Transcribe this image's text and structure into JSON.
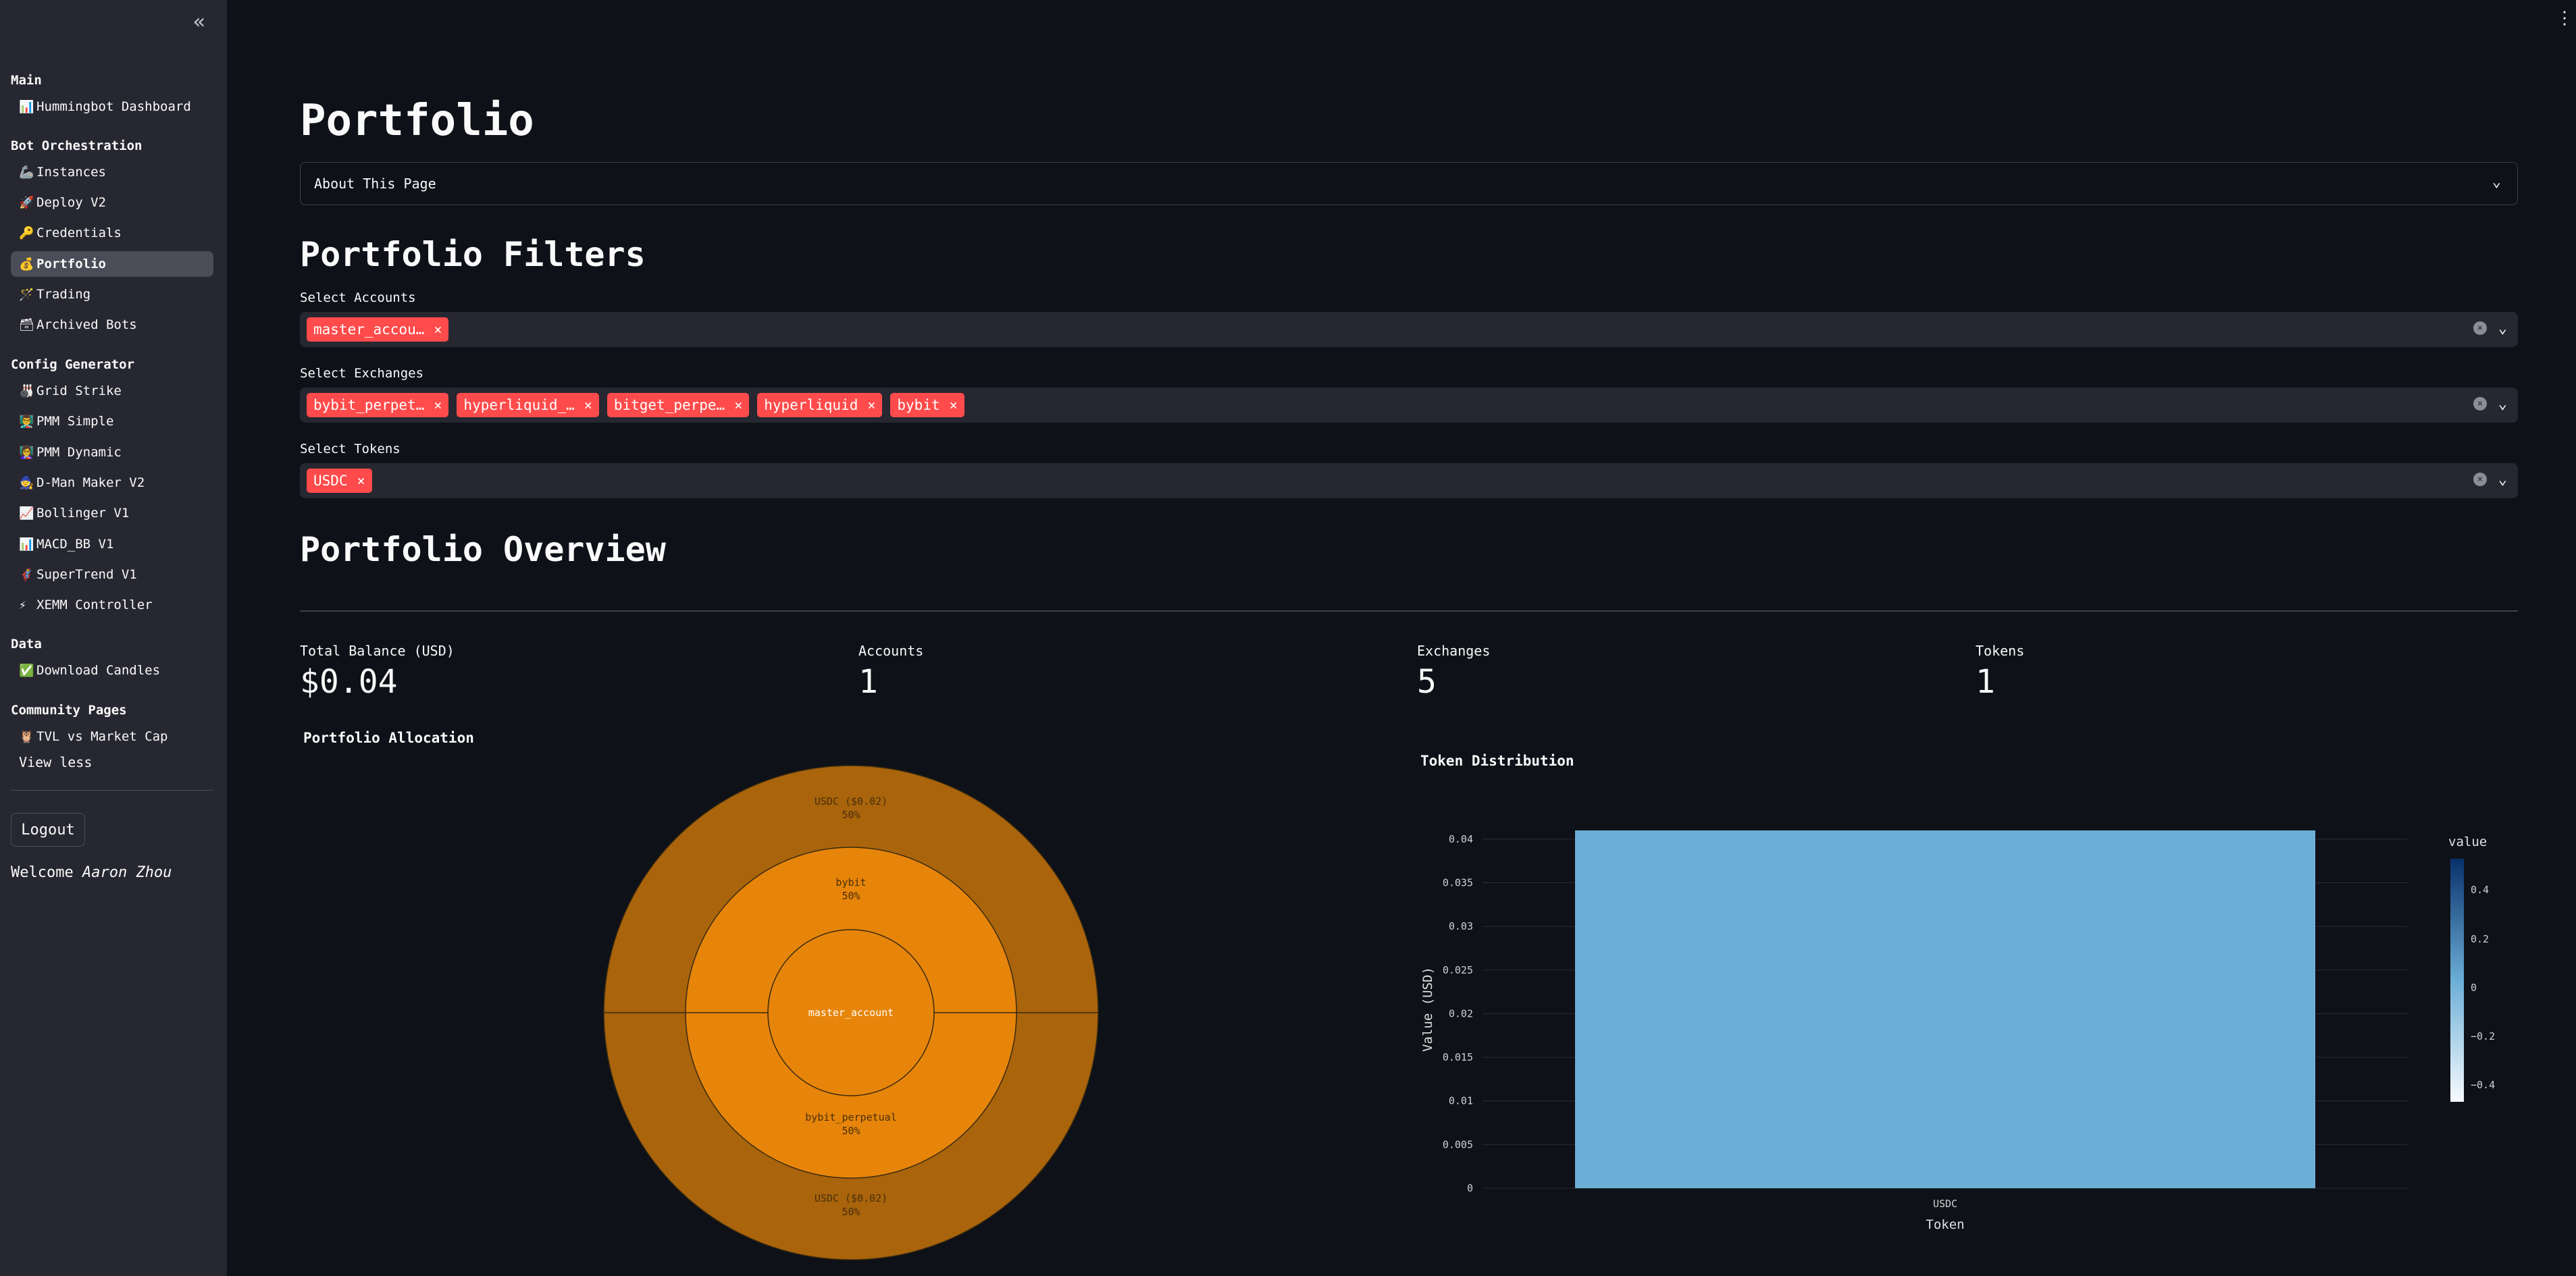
{
  "sidebar": {
    "collapse_icon": "double-chevron-left-icon",
    "groups": [
      {
        "label": "Main",
        "items": [
          {
            "icon": "📊",
            "label": "Hummingbot Dashboard"
          }
        ]
      },
      {
        "label": "Bot Orchestration",
        "items": [
          {
            "icon": "🦾",
            "label": "Instances"
          },
          {
            "icon": "🚀",
            "label": "Deploy V2"
          },
          {
            "icon": "🔑",
            "label": "Credentials"
          },
          {
            "icon": "💰",
            "label": "Portfolio",
            "active": true
          },
          {
            "icon": "🪄",
            "label": "Trading"
          },
          {
            "icon": "🗃",
            "label": "Archived Bots"
          }
        ]
      },
      {
        "label": "Config Generator",
        "items": [
          {
            "icon": "🎳",
            "label": "Grid Strike"
          },
          {
            "icon": "👨‍🏫",
            "label": "PMM Simple"
          },
          {
            "icon": "👩‍🏫",
            "label": "PMM Dynamic"
          },
          {
            "icon": "🧙",
            "label": "D-Man Maker V2"
          },
          {
            "icon": "📈",
            "label": "Bollinger V1"
          },
          {
            "icon": "📊",
            "label": "MACD_BB V1"
          },
          {
            "icon": "🦸",
            "label": "SuperTrend V1"
          },
          {
            "icon": "⚡",
            "label": "XEMM Controller"
          }
        ]
      },
      {
        "label": "Data",
        "items": [
          {
            "icon": "✅",
            "label": "Download Candles"
          }
        ]
      },
      {
        "label": "Community Pages",
        "items": [
          {
            "icon": "🦉",
            "label": "TVL vs Market Cap"
          }
        ]
      }
    ],
    "view_less": "View less",
    "logout": "Logout",
    "welcome_prefix": "Welcome",
    "welcome_user": "Aaron Zhou"
  },
  "main": {
    "title": "Portfolio",
    "expander": "About This Page",
    "filters_title": "Portfolio Filters",
    "filters": [
      {
        "label": "Select Accounts",
        "tags": [
          "master_accou…"
        ]
      },
      {
        "label": "Select Exchanges",
        "tags": [
          "bybit_perpet…",
          "hyperliquid_…",
          "bitget_perpe…",
          "hyperliquid",
          "bybit"
        ]
      },
      {
        "label": "Select Tokens",
        "tags": [
          "USDC"
        ]
      }
    ],
    "overview_title": "Portfolio Overview",
    "metrics": [
      {
        "label": "Total Balance (USD)",
        "value": "$0.04"
      },
      {
        "label": "Accounts",
        "value": "1"
      },
      {
        "label": "Exchanges",
        "value": "5"
      },
      {
        "label": "Tokens",
        "value": "1"
      }
    ]
  },
  "colors": {
    "accent": "#ff4b4b",
    "sunburst_inner": "#e6850a",
    "sunburst_outer": "#a9640c",
    "bar": "#6baed6"
  },
  "chart_data": [
    {
      "type": "sunburst",
      "title": "Portfolio Allocation",
      "center": {
        "label": "master_account"
      },
      "rings": [
        [
          {
            "label": "bybit",
            "pct": "50%"
          },
          {
            "label": "bybit_perpetual",
            "pct": "50%"
          }
        ],
        [
          {
            "label": "USDC ($0.02)",
            "pct": "50%"
          },
          {
            "label": "USDC ($0.02)",
            "pct": "50%"
          }
        ]
      ]
    },
    {
      "type": "bar",
      "title": "Token Distribution",
      "categories": [
        "USDC"
      ],
      "values": [
        0.041
      ],
      "xlabel": "Token",
      "ylabel": "Value (USD)",
      "ylim": [
        0,
        0.041
      ],
      "yticks": [
        "0",
        "0.005",
        "0.01",
        "0.015",
        "0.02",
        "0.025",
        "0.03",
        "0.035",
        "0.04"
      ],
      "colorbar": {
        "title": "value",
        "ticks": [
          "0.4",
          "0.2",
          "0",
          "−0.2",
          "−0.4"
        ]
      }
    }
  ]
}
